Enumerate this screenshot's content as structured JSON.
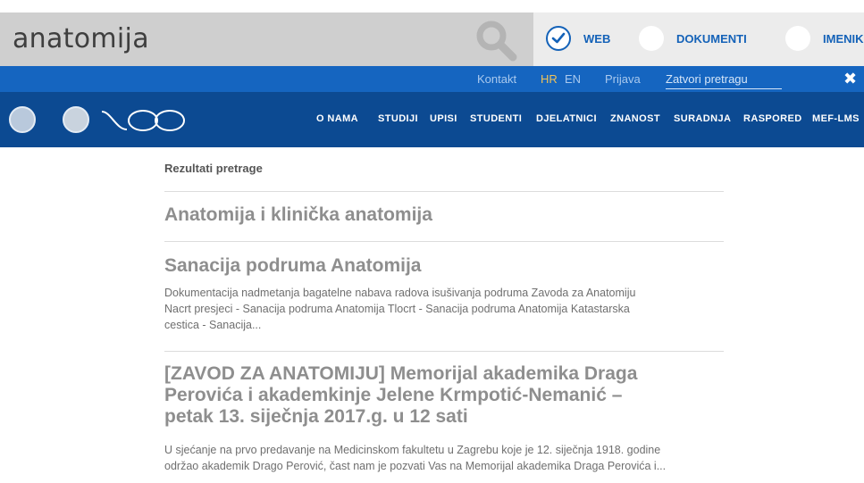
{
  "search": {
    "query": "anatomija",
    "filters": [
      {
        "label": "WEB",
        "checked": true
      },
      {
        "label": "DOKUMENTI",
        "checked": false
      },
      {
        "label": "IMENIK",
        "checked": false
      }
    ]
  },
  "utility_bar": {
    "contact": "Kontakt",
    "lang_hr": "HR",
    "lang_en": "EN",
    "login": "Prijava",
    "close_search": "Zatvori pretragu",
    "close_icon": "✖"
  },
  "nav": {
    "items": [
      "O NAMA",
      "STUDIJI",
      "UPISI",
      "STUDENTI",
      "DJELATNICI",
      "ZNANOST",
      "SURADNJA",
      "RASPORED",
      "MEF-LMS"
    ]
  },
  "results": {
    "heading": "Rezultati pretrage",
    "items": [
      {
        "title": "Anatomija i klinička anatomija",
        "snippet": ""
      },
      {
        "title": "Sanacija podruma Anatomija",
        "snippet_lines": [
          "Dokumentacija nadmetanja bagatelne nabava radova isušivanja podruma Zavoda za Anatomiju",
          "Nacrt presjeci - Sanacija podruma Anatomija Tlocrt - Sanacija podruma Anatomija Katastarska",
          "cestica - Sanacija..."
        ]
      },
      {
        "title_lines": [
          "[ZAVOD ZA ANATOMIJU] Memorijal akademika Draga",
          "Perovića i akademkinje Jelene Krmpotić-Nemanić –",
          "petak 13. siječnja 2017.g. u 12 sati"
        ],
        "snippet_lines": [
          "U sjećanje na prvo predavanje na Medicinskom fakultetu u Zagrebu koje je 12. siječnja 1918. godine",
          "održao akademik Drago Perović, čast nam je pozvati Vas na Memorijal akademika Draga Perovića i..."
        ]
      }
    ]
  },
  "colors": {
    "utility_bar": "#1565c0",
    "main_nav": "#0c4a92",
    "accent": "#1462b8",
    "lang_active": "#f0c35a"
  },
  "icons": [
    "search-icon",
    "check-icon",
    "close-icon",
    "university-seal-icon",
    "faculty-seal-icon",
    "centenary-100-logo"
  ]
}
